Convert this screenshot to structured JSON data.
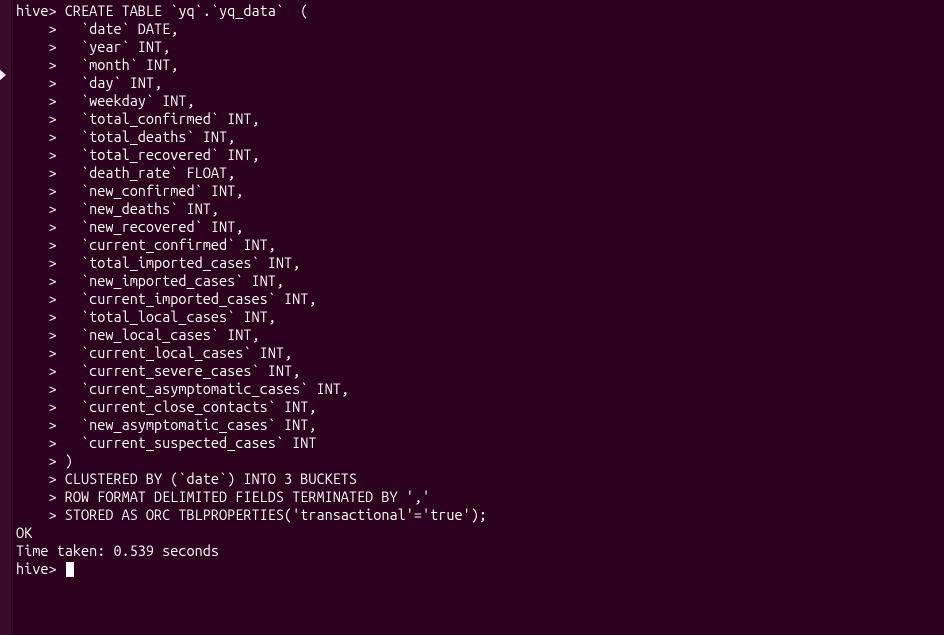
{
  "terminal": {
    "prompt_main": "hive>",
    "prompt_cont": "    >",
    "lines": [
      {
        "prompt": "hive>",
        "text": " CREATE TABLE `yq`.`yq_data`  ("
      },
      {
        "prompt": "    >",
        "text": "   `date` DATE,"
      },
      {
        "prompt": "    >",
        "text": "   `year` INT,"
      },
      {
        "prompt": "    >",
        "text": "   `month` INT,"
      },
      {
        "prompt": "    >",
        "text": "   `day` INT,"
      },
      {
        "prompt": "    >",
        "text": "   `weekday` INT,"
      },
      {
        "prompt": "    >",
        "text": "   `total_confirmed` INT,"
      },
      {
        "prompt": "    >",
        "text": "   `total_deaths` INT,"
      },
      {
        "prompt": "    >",
        "text": "   `total_recovered` INT,"
      },
      {
        "prompt": "    >",
        "text": "   `death_rate` FLOAT,"
      },
      {
        "prompt": "    >",
        "text": "   `new_confirmed` INT,"
      },
      {
        "prompt": "    >",
        "text": "   `new_deaths` INT,"
      },
      {
        "prompt": "    >",
        "text": "   `new_recovered` INT,"
      },
      {
        "prompt": "    >",
        "text": "   `current_confirmed` INT,"
      },
      {
        "prompt": "    >",
        "text": "   `total_imported_cases` INT,"
      },
      {
        "prompt": "    >",
        "text": "   `new_imported_cases` INT,"
      },
      {
        "prompt": "    >",
        "text": "   `current_imported_cases` INT,"
      },
      {
        "prompt": "    >",
        "text": "   `total_local_cases` INT,"
      },
      {
        "prompt": "    >",
        "text": "   `new_local_cases` INT,"
      },
      {
        "prompt": "    >",
        "text": "   `current_local_cases` INT,"
      },
      {
        "prompt": "    >",
        "text": "   `current_severe_cases` INT,"
      },
      {
        "prompt": "    >",
        "text": "   `current_asymptomatic_cases` INT,"
      },
      {
        "prompt": "    >",
        "text": "   `current_close_contacts` INT,"
      },
      {
        "prompt": "    >",
        "text": "   `new_asymptomatic_cases` INT,"
      },
      {
        "prompt": "    >",
        "text": "   `current_suspected_cases` INT"
      },
      {
        "prompt": "    >",
        "text": " )"
      },
      {
        "prompt": "    >",
        "text": " CLUSTERED BY (`date`) INTO 3 BUCKETS"
      },
      {
        "prompt": "    >",
        "text": " ROW FORMAT DELIMITED FIELDS TERMINATED BY ','"
      },
      {
        "prompt": "    >",
        "text": " STORED AS ORC TBLPROPERTIES('transactional'='true');"
      }
    ],
    "result": [
      "OK",
      "Time taken: 0.539 seconds"
    ],
    "current_prompt": "hive>"
  }
}
